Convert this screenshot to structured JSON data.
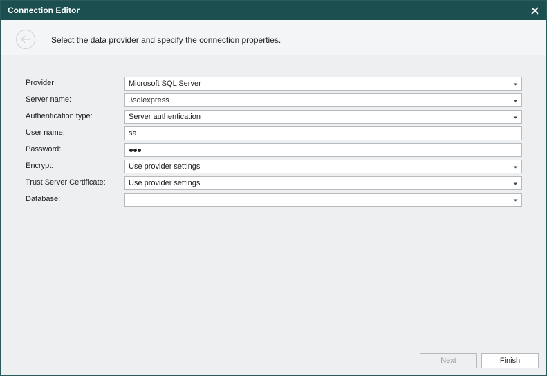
{
  "window": {
    "title": "Connection Editor"
  },
  "header": {
    "instruction": "Select the data provider and specify the connection properties."
  },
  "form": {
    "provider": {
      "label": "Provider:",
      "value": "Microsoft SQL Server"
    },
    "server_name": {
      "label": "Server name:",
      "value": ".\\sqlexpress"
    },
    "authentication_type": {
      "label": "Authentication type:",
      "value": "Server authentication"
    },
    "user_name": {
      "label": "User name:",
      "value": "sa"
    },
    "password": {
      "label": "Password:",
      "masked_length": 3
    },
    "encrypt": {
      "label": "Encrypt:",
      "value": "Use provider settings"
    },
    "trust_server_certificate": {
      "label": "Trust Server Certificate:",
      "value": "Use provider settings"
    },
    "database": {
      "label": "Database:",
      "value": ""
    }
  },
  "footer": {
    "next_label": "Next",
    "finish_label": "Finish"
  },
  "icons": {
    "close": "close-icon",
    "back": "back-arrow-icon",
    "dropdown": "chevron-down-icon"
  },
  "colors": {
    "titlebar": "#1c4f50",
    "background": "#eeeff1"
  }
}
